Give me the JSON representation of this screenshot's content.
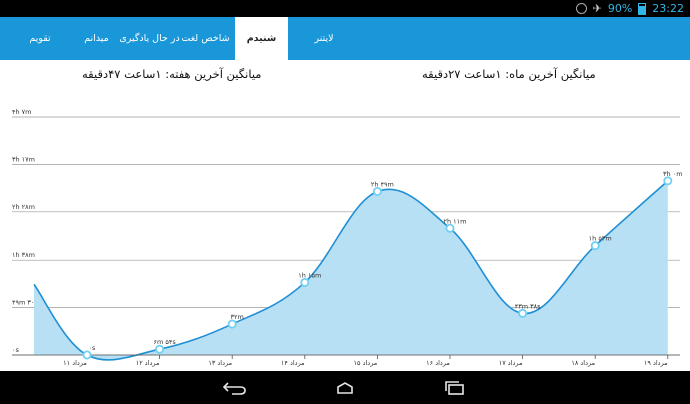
{
  "status": {
    "battery": "90%",
    "time": "23:22"
  },
  "tabs": [
    {
      "label": "لایتنر"
    },
    {
      "label": "شنیدم"
    },
    {
      "label": "شاخص لغت"
    },
    {
      "label": "در حال یادگیری"
    },
    {
      "label": "میدانم"
    },
    {
      "label": "تقویم"
    }
  ],
  "active_tab": "شنیدم",
  "summary": {
    "month": "میانگین آخرین ماه: ۱ساعت ۲۷دقیقه",
    "week": "میانگین آخرین هفته: ۱ساعت ۴۷دقیقه"
  },
  "colors": {
    "accent": "#1a97d9",
    "line": "#1f8fd4",
    "fill": "#b8e0f5"
  },
  "chart_data": {
    "type": "area",
    "x_labels": [
      "۱۱ مرداد",
      "۱۲ مرداد",
      "۱۳ مرداد",
      "۱۴ مرداد",
      "۱۵ مرداد",
      "۱۶ مرداد",
      "۱۷ مرداد",
      "۱۸ مرداد",
      "۱۹ مرداد"
    ],
    "values": [
      0,
      6,
      32,
      75,
      169,
      131,
      43,
      113,
      180
    ],
    "point_labels": [
      "۰s",
      "۶m ۵۴s",
      "۳۲m",
      "۱h ۱۵m",
      "۲h ۴۹m",
      "۲h ۱۱m",
      "۴۳m ۳۸s",
      "۱h ۵۳m",
      "۳h ۰m"
    ],
    "y_ticks": [
      0,
      49,
      98,
      148,
      197,
      246
    ],
    "y_tick_labels": [
      "۰s",
      "۴۹m ۳۰s",
      "۱h ۳۸m",
      "۲h ۲۸m",
      "۳h ۱۷m",
      "۴h ۷m"
    ],
    "ylim": [
      0,
      246
    ],
    "grid": true,
    "legend": "none"
  }
}
